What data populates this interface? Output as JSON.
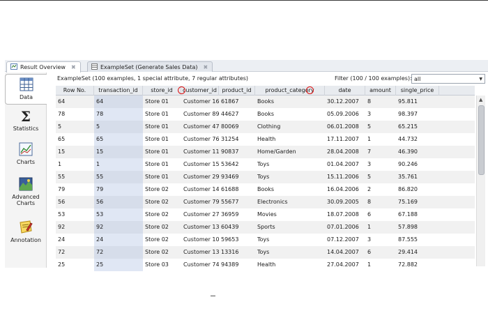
{
  "tabs": [
    {
      "label": "Result Overview",
      "active": true
    },
    {
      "label": "ExampleSet (Generate Sales Data)",
      "active": false
    }
  ],
  "sidebar": {
    "items": [
      {
        "label": "Data",
        "icon": "data-table-icon",
        "active": true
      },
      {
        "label": "Statistics",
        "icon": "sigma-icon",
        "active": false
      },
      {
        "label": "Charts",
        "icon": "chart-icon",
        "active": false
      },
      {
        "label": "Advanced Charts",
        "icon": "advanced-chart-icon",
        "active": false
      },
      {
        "label": "Annotation",
        "icon": "annotation-icon",
        "active": false
      }
    ]
  },
  "main": {
    "info": "ExampleSet (100 examples, 1 special attribute, 7 regular attributes)",
    "filter_label": "Filter (100 / 100 examples):",
    "filter_value": "all"
  },
  "table": {
    "columns": [
      "Row No.",
      "transaction_id",
      "store_id",
      "customer_id",
      "product_id",
      "product_category",
      "date",
      "amount",
      "single_price"
    ],
    "rows": [
      [
        "64",
        "64",
        "Store 01",
        "Customer 16",
        "61867",
        "Books",
        "30.12.2007",
        "8",
        "95.811"
      ],
      [
        "78",
        "78",
        "Store 01",
        "Customer 89",
        "44627",
        "Books",
        "05.09.2006",
        "3",
        "98.397"
      ],
      [
        "5",
        "5",
        "Store 01",
        "Customer 47",
        "80069",
        "Clothing",
        "06.01.2008",
        "5",
        "65.215"
      ],
      [
        "65",
        "65",
        "Store 01",
        "Customer 76",
        "31254",
        "Health",
        "17.11.2007",
        "1",
        "44.732"
      ],
      [
        "15",
        "15",
        "Store 01",
        "Customer 11",
        "90837",
        "Home/Garden",
        "28.04.2008",
        "7",
        "46.390"
      ],
      [
        "1",
        "1",
        "Store 01",
        "Customer 15",
        "53642",
        "Toys",
        "01.04.2007",
        "3",
        "90.246"
      ],
      [
        "55",
        "55",
        "Store 01",
        "Customer 29",
        "93469",
        "Toys",
        "15.11.2006",
        "5",
        "35.761"
      ],
      [
        "79",
        "79",
        "Store 02",
        "Customer 14",
        "61688",
        "Books",
        "16.04.2006",
        "2",
        "86.820"
      ],
      [
        "56",
        "56",
        "Store 02",
        "Customer 79",
        "55677",
        "Electronics",
        "30.09.2005",
        "8",
        "75.169"
      ],
      [
        "53",
        "53",
        "Store 02",
        "Customer 27",
        "36959",
        "Movies",
        "18.07.2008",
        "6",
        "67.188"
      ],
      [
        "92",
        "92",
        "Store 02",
        "Customer 13",
        "60439",
        "Sports",
        "07.01.2006",
        "1",
        "57.898"
      ],
      [
        "24",
        "24",
        "Store 02",
        "Customer 10",
        "59653",
        "Toys",
        "07.12.2007",
        "3",
        "87.555"
      ],
      [
        "72",
        "72",
        "Store 02",
        "Customer 13",
        "13316",
        "Toys",
        "14.04.2007",
        "6",
        "29.414"
      ],
      [
        "25",
        "25",
        "Store 03",
        "Customer 74",
        "94389",
        "Health",
        "27.04.2007",
        "1",
        "72.882"
      ]
    ]
  },
  "colors": {
    "header_bg": "#e8ebef",
    "id_column_tint": "#a0b4dc",
    "marker_red": "#dd1111",
    "tab_strip": "#eceff3"
  }
}
